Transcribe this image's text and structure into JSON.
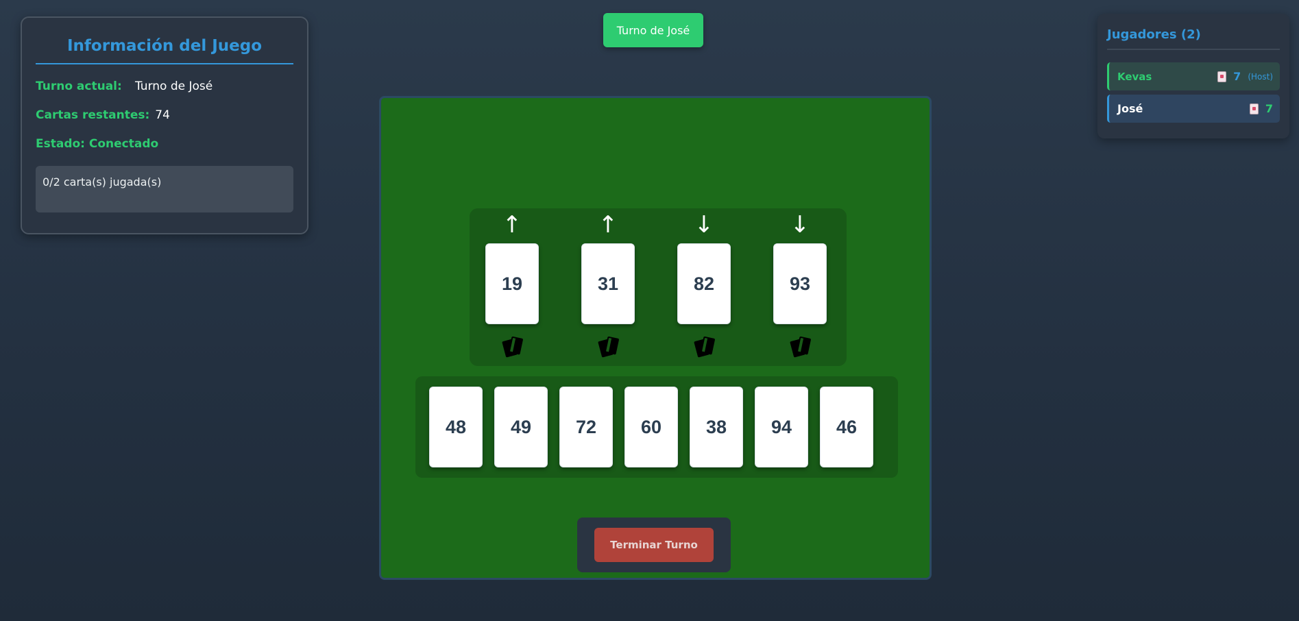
{
  "info_panel": {
    "title": "Información del Juego",
    "turn_label": "Turno actual:",
    "turn_value": "Turno de José",
    "cards_label": "Cartas restantes:",
    "cards_value": "74",
    "status_label": "Estado: Conectado",
    "plays_text": "0/2 carta(s) jugada(s)"
  },
  "turn_indicator": "Turno de José",
  "players_panel": {
    "title": "Jugadores (2)",
    "players": [
      {
        "name": "Kevas",
        "cards": "7",
        "tag": "(Host)",
        "icon": "card-icon"
      },
      {
        "name": "José",
        "cards": "7",
        "tag": "",
        "icon": "card-icon"
      }
    ]
  },
  "piles": [
    {
      "direction": "up",
      "arrow": "↑",
      "value": "19",
      "icon": "card-stack-icon"
    },
    {
      "direction": "up",
      "arrow": "↑",
      "value": "31",
      "icon": "card-stack-icon"
    },
    {
      "direction": "down",
      "arrow": "↓",
      "value": "82",
      "icon": "card-stack-icon"
    },
    {
      "direction": "down",
      "arrow": "↓",
      "value": "93",
      "icon": "card-stack-icon"
    }
  ],
  "hand": [
    "48",
    "49",
    "72",
    "60",
    "38",
    "94",
    "46"
  ],
  "end_turn_label": "Terminar Turno",
  "colors": {
    "accent_blue": "#3498db",
    "accent_green": "#2ecc71",
    "table_green": "#1c6b1a",
    "end_turn_red": "#b0433a"
  }
}
